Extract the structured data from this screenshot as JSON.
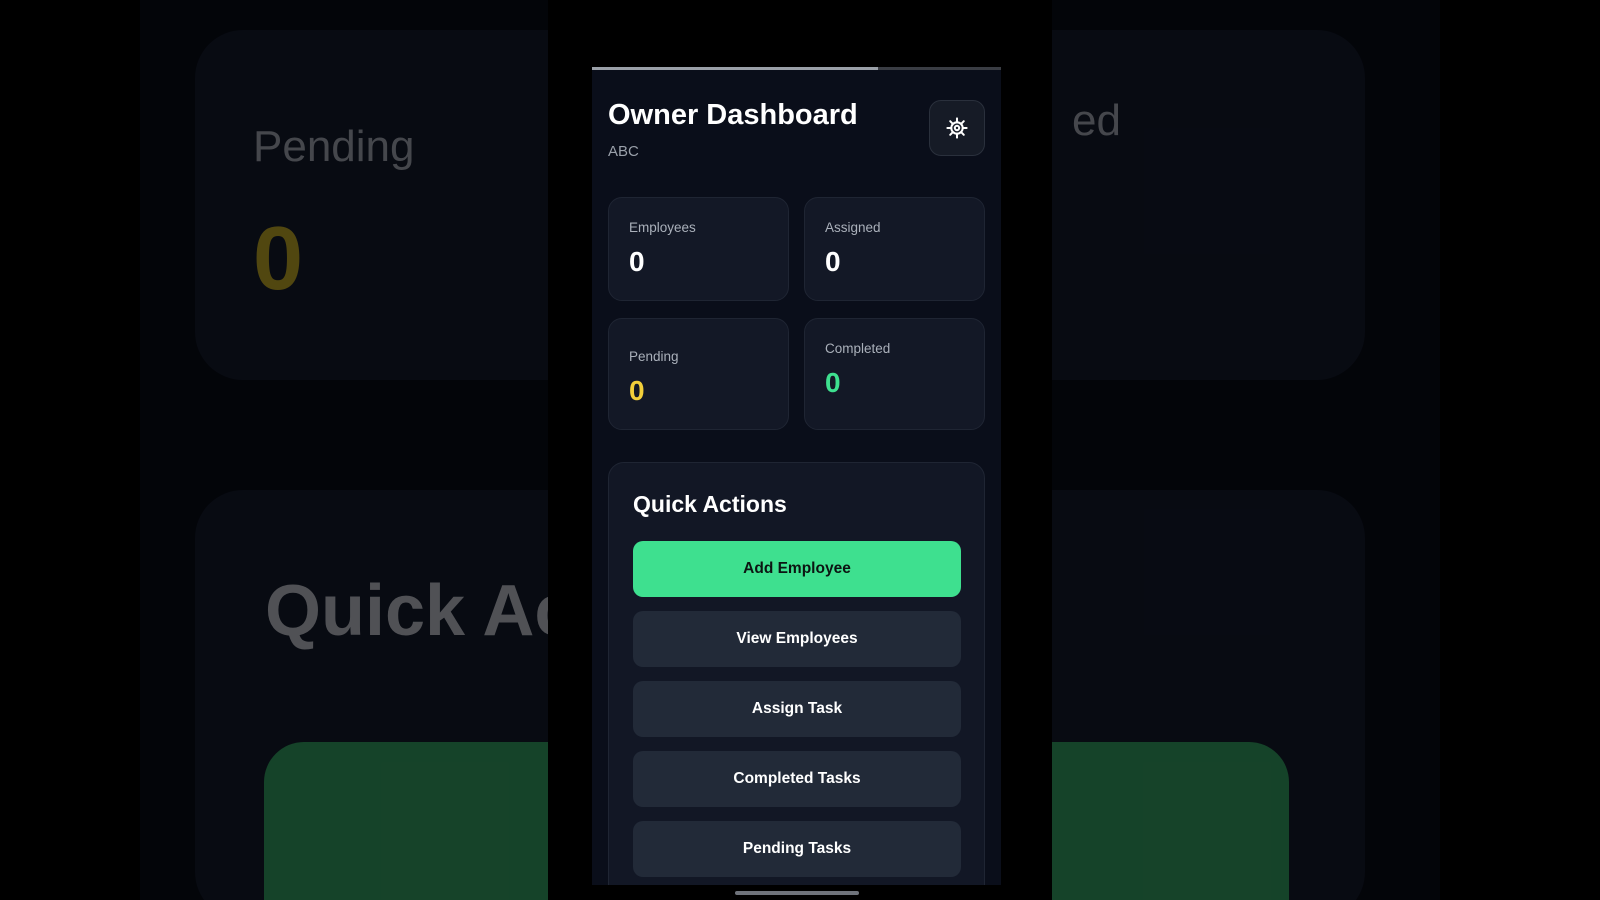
{
  "background": {
    "stat_label": "Pending",
    "stat_value": "0",
    "stat_label_right": "ed",
    "heading": "Quick Ac"
  },
  "progress": {
    "fraction": 0.7
  },
  "header": {
    "title": "Owner Dashboard",
    "subtitle": "ABC",
    "settings_icon": "gear-icon"
  },
  "stats": [
    {
      "label": "Employees",
      "value": "0",
      "color": "#ffffff"
    },
    {
      "label": "Assigned",
      "value": "0",
      "color": "#ffffff"
    },
    {
      "label": "Pending",
      "value": "0",
      "color": "#f2cf3a"
    },
    {
      "label": "Completed",
      "value": "0",
      "color": "#3ee08f"
    }
  ],
  "quick_actions": {
    "title": "Quick Actions",
    "buttons": [
      {
        "label": "Add Employee",
        "style": "primary"
      },
      {
        "label": "View Employees",
        "style": "secondary"
      },
      {
        "label": "Assign Task",
        "style": "secondary"
      },
      {
        "label": "Completed Tasks",
        "style": "secondary"
      },
      {
        "label": "Pending Tasks",
        "style": "secondary"
      }
    ]
  },
  "colors": {
    "accent_green": "#3ee08f",
    "pending_yellow": "#f2cf3a",
    "background": "#0a0e1a",
    "card": "#131826"
  }
}
